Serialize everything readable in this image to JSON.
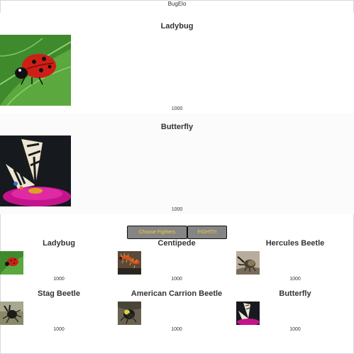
{
  "app": {
    "title": "BugElo"
  },
  "matchup": {
    "fighter_a": {
      "name": "Ladybug",
      "elo": "1000",
      "icon": "ladybug-photo"
    },
    "fighter_b": {
      "name": "Butterfly",
      "elo": "1000",
      "icon": "butterfly-photo"
    }
  },
  "actions": {
    "choose_label": "Choose Fighters",
    "fight_label": "FIGHT!!!"
  },
  "roster": [
    {
      "name": "Ladybug",
      "elo": "1000",
      "icon": "ladybug-photo"
    },
    {
      "name": "Centipede",
      "elo": "1000",
      "icon": "centipede-photo"
    },
    {
      "name": "Hercules Beetle",
      "elo": "1000",
      "icon": "hercules-beetle-photo"
    },
    {
      "name": "Stag Beetle",
      "elo": "1000",
      "icon": "stag-beetle-photo"
    },
    {
      "name": "American Carrion Beetle",
      "elo": "1000",
      "icon": "carrion-beetle-photo"
    },
    {
      "name": "Butterfly",
      "elo": "1000",
      "icon": "butterfly-photo"
    }
  ],
  "colors": {
    "button_bg": "#858585",
    "button_text": "#f1cf3c",
    "leaf_green": "#4e9a36",
    "ladybug_red": "#c81e14"
  }
}
